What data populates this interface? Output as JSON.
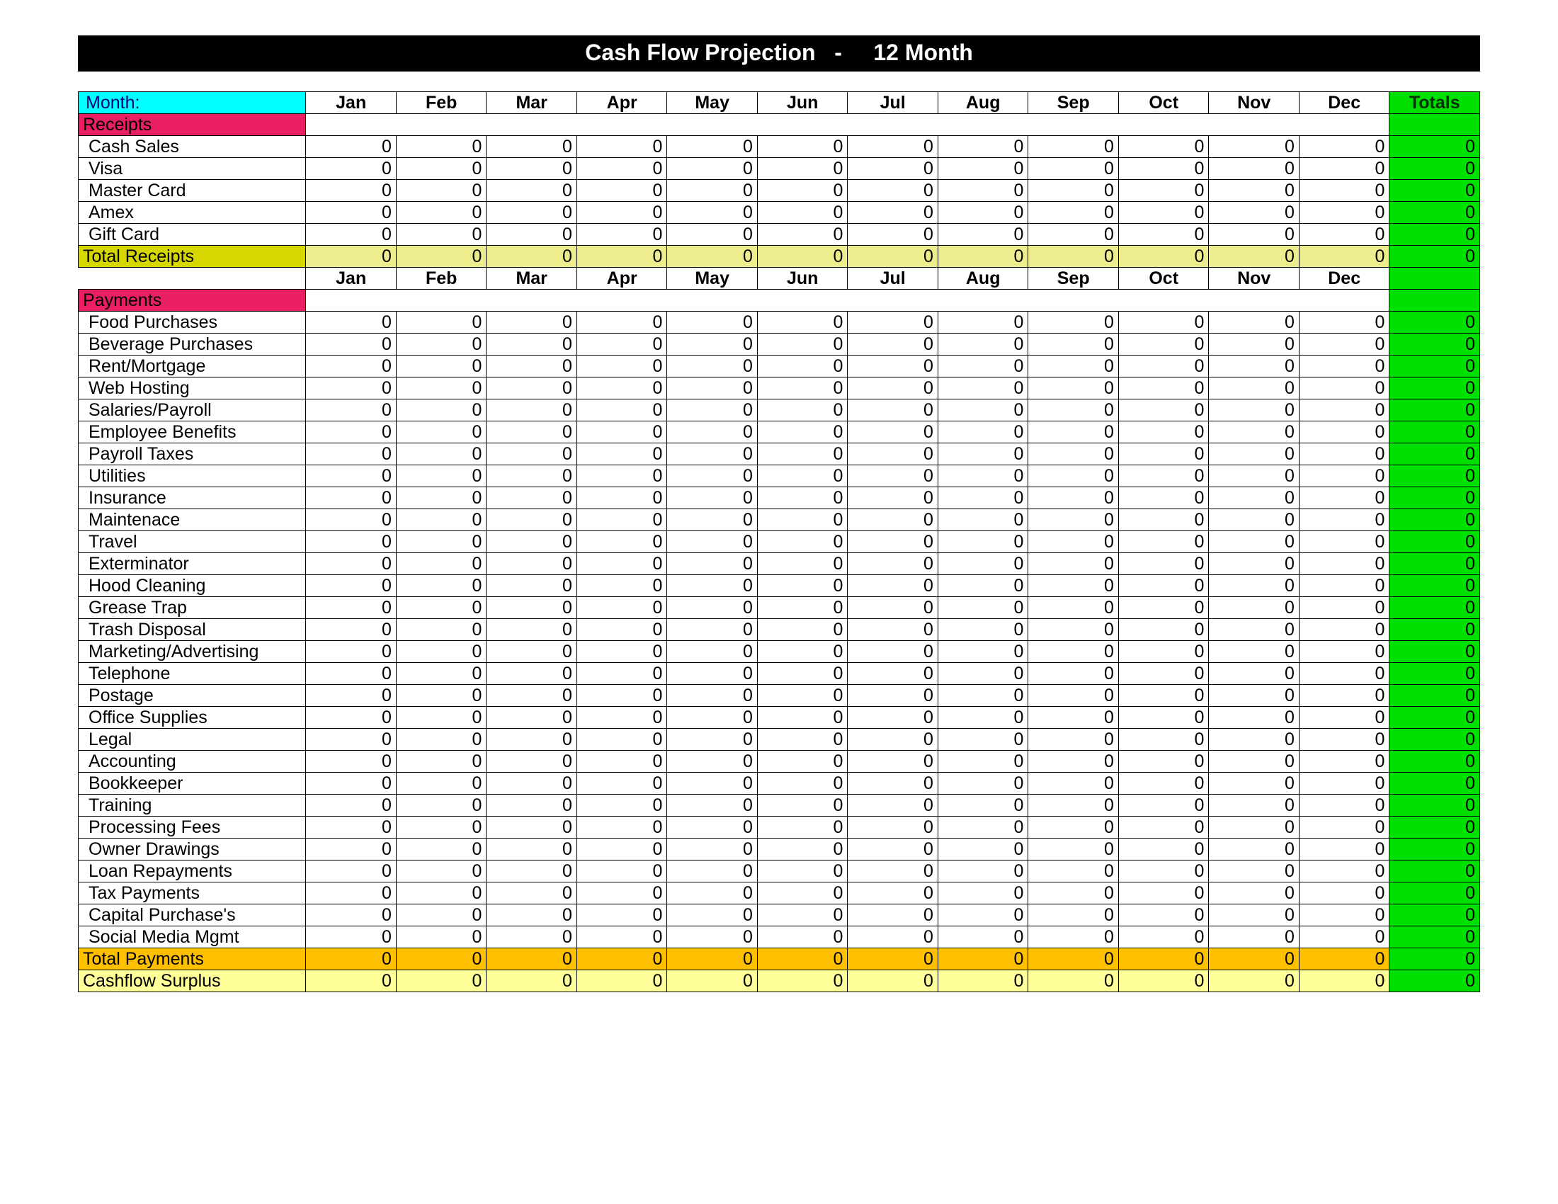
{
  "title": "Cash Flow Projection   -     12 Month",
  "monthLabel": "Month:",
  "totalsLabel": "Totals",
  "months": [
    "Jan",
    "Feb",
    "Mar",
    "Apr",
    "May",
    "Jun",
    "Jul",
    "Aug",
    "Sep",
    "Oct",
    "Nov",
    "Dec"
  ],
  "sections": {
    "receipts": {
      "label": "Receipts",
      "rows": [
        {
          "label": "Cash Sales",
          "values": [
            0,
            0,
            0,
            0,
            0,
            0,
            0,
            0,
            0,
            0,
            0,
            0
          ],
          "total": 0
        },
        {
          "label": "Visa",
          "values": [
            0,
            0,
            0,
            0,
            0,
            0,
            0,
            0,
            0,
            0,
            0,
            0
          ],
          "total": 0
        },
        {
          "label": "Master Card",
          "values": [
            0,
            0,
            0,
            0,
            0,
            0,
            0,
            0,
            0,
            0,
            0,
            0
          ],
          "total": 0
        },
        {
          "label": "Amex",
          "values": [
            0,
            0,
            0,
            0,
            0,
            0,
            0,
            0,
            0,
            0,
            0,
            0
          ],
          "total": 0
        },
        {
          "label": "Gift Card",
          "values": [
            0,
            0,
            0,
            0,
            0,
            0,
            0,
            0,
            0,
            0,
            0,
            0
          ],
          "total": 0
        }
      ],
      "totalLabel": "Total Receipts",
      "totals": [
        0,
        0,
        0,
        0,
        0,
        0,
        0,
        0,
        0,
        0,
        0,
        0
      ],
      "grandTotal": 0
    },
    "payments": {
      "label": "Payments",
      "rows": [
        {
          "label": "Food Purchases",
          "values": [
            0,
            0,
            0,
            0,
            0,
            0,
            0,
            0,
            0,
            0,
            0,
            0
          ],
          "total": 0
        },
        {
          "label": "Beverage Purchases",
          "values": [
            0,
            0,
            0,
            0,
            0,
            0,
            0,
            0,
            0,
            0,
            0,
            0
          ],
          "total": 0
        },
        {
          "label": "Rent/Mortgage",
          "values": [
            0,
            0,
            0,
            0,
            0,
            0,
            0,
            0,
            0,
            0,
            0,
            0
          ],
          "total": 0
        },
        {
          "label": "Web Hosting",
          "values": [
            0,
            0,
            0,
            0,
            0,
            0,
            0,
            0,
            0,
            0,
            0,
            0
          ],
          "total": 0
        },
        {
          "label": "Salaries/Payroll",
          "values": [
            0,
            0,
            0,
            0,
            0,
            0,
            0,
            0,
            0,
            0,
            0,
            0
          ],
          "total": 0
        },
        {
          "label": "Employee Benefits",
          "values": [
            0,
            0,
            0,
            0,
            0,
            0,
            0,
            0,
            0,
            0,
            0,
            0
          ],
          "total": 0
        },
        {
          "label": "Payroll Taxes",
          "values": [
            0,
            0,
            0,
            0,
            0,
            0,
            0,
            0,
            0,
            0,
            0,
            0
          ],
          "total": 0
        },
        {
          "label": "Utilities",
          "values": [
            0,
            0,
            0,
            0,
            0,
            0,
            0,
            0,
            0,
            0,
            0,
            0
          ],
          "total": 0
        },
        {
          "label": "Insurance",
          "values": [
            0,
            0,
            0,
            0,
            0,
            0,
            0,
            0,
            0,
            0,
            0,
            0
          ],
          "total": 0
        },
        {
          "label": "Maintenace",
          "values": [
            0,
            0,
            0,
            0,
            0,
            0,
            0,
            0,
            0,
            0,
            0,
            0
          ],
          "total": 0
        },
        {
          "label": "Travel",
          "values": [
            0,
            0,
            0,
            0,
            0,
            0,
            0,
            0,
            0,
            0,
            0,
            0
          ],
          "total": 0
        },
        {
          "label": "Exterminator",
          "values": [
            0,
            0,
            0,
            0,
            0,
            0,
            0,
            0,
            0,
            0,
            0,
            0
          ],
          "total": 0
        },
        {
          "label": "Hood Cleaning",
          "values": [
            0,
            0,
            0,
            0,
            0,
            0,
            0,
            0,
            0,
            0,
            0,
            0
          ],
          "total": 0
        },
        {
          "label": "Grease Trap",
          "values": [
            0,
            0,
            0,
            0,
            0,
            0,
            0,
            0,
            0,
            0,
            0,
            0
          ],
          "total": 0
        },
        {
          "label": "Trash Disposal",
          "values": [
            0,
            0,
            0,
            0,
            0,
            0,
            0,
            0,
            0,
            0,
            0,
            0
          ],
          "total": 0
        },
        {
          "label": "Marketing/Advertising",
          "values": [
            0,
            0,
            0,
            0,
            0,
            0,
            0,
            0,
            0,
            0,
            0,
            0
          ],
          "total": 0
        },
        {
          "label": "Telephone",
          "values": [
            0,
            0,
            0,
            0,
            0,
            0,
            0,
            0,
            0,
            0,
            0,
            0
          ],
          "total": 0
        },
        {
          "label": "Postage",
          "values": [
            0,
            0,
            0,
            0,
            0,
            0,
            0,
            0,
            0,
            0,
            0,
            0
          ],
          "total": 0
        },
        {
          "label": "Office Supplies",
          "values": [
            0,
            0,
            0,
            0,
            0,
            0,
            0,
            0,
            0,
            0,
            0,
            0
          ],
          "total": 0
        },
        {
          "label": "Legal",
          "values": [
            0,
            0,
            0,
            0,
            0,
            0,
            0,
            0,
            0,
            0,
            0,
            0
          ],
          "total": 0
        },
        {
          "label": "Accounting",
          "values": [
            0,
            0,
            0,
            0,
            0,
            0,
            0,
            0,
            0,
            0,
            0,
            0
          ],
          "total": 0
        },
        {
          "label": "Bookkeeper",
          "values": [
            0,
            0,
            0,
            0,
            0,
            0,
            0,
            0,
            0,
            0,
            0,
            0
          ],
          "total": 0
        },
        {
          "label": "Training",
          "values": [
            0,
            0,
            0,
            0,
            0,
            0,
            0,
            0,
            0,
            0,
            0,
            0
          ],
          "total": 0
        },
        {
          "label": "Processing Fees",
          "values": [
            0,
            0,
            0,
            0,
            0,
            0,
            0,
            0,
            0,
            0,
            0,
            0
          ],
          "total": 0
        },
        {
          "label": "Owner Drawings",
          "values": [
            0,
            0,
            0,
            0,
            0,
            0,
            0,
            0,
            0,
            0,
            0,
            0
          ],
          "total": 0
        },
        {
          "label": "Loan Repayments",
          "values": [
            0,
            0,
            0,
            0,
            0,
            0,
            0,
            0,
            0,
            0,
            0,
            0
          ],
          "total": 0
        },
        {
          "label": "Tax Payments",
          "values": [
            0,
            0,
            0,
            0,
            0,
            0,
            0,
            0,
            0,
            0,
            0,
            0
          ],
          "total": 0
        },
        {
          "label": "Capital Purchase's",
          "values": [
            0,
            0,
            0,
            0,
            0,
            0,
            0,
            0,
            0,
            0,
            0,
            0
          ],
          "total": 0
        },
        {
          "label": "Social Media Mgmt",
          "values": [
            0,
            0,
            0,
            0,
            0,
            0,
            0,
            0,
            0,
            0,
            0,
            0
          ],
          "total": 0
        }
      ],
      "totalLabel": "Total Payments",
      "totals": [
        0,
        0,
        0,
        0,
        0,
        0,
        0,
        0,
        0,
        0,
        0,
        0
      ],
      "grandTotal": 0
    },
    "surplus": {
      "label": "Cashflow Surplus",
      "values": [
        0,
        0,
        0,
        0,
        0,
        0,
        0,
        0,
        0,
        0,
        0,
        0
      ],
      "total": 0
    }
  }
}
